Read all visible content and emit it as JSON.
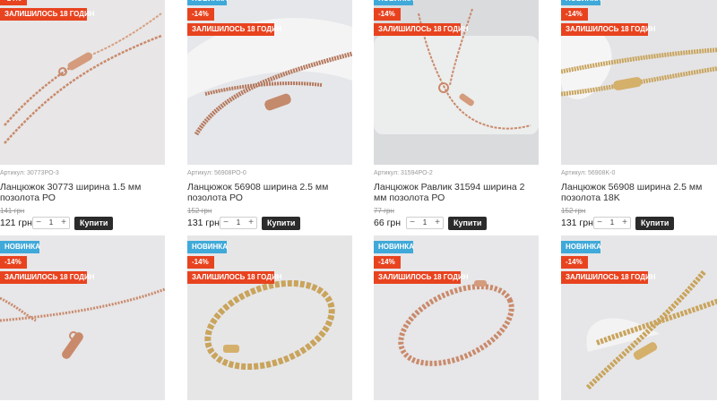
{
  "badges": {
    "new": "НОВИНКА",
    "discount": "-14%",
    "left": "ЗАЛИШИЛОСЬ 18 ГОДИН"
  },
  "buy_label": "Купити",
  "products": [
    {
      "sku": "Артикул: 30773PO-3",
      "name": "Ланцюжок 30773 ширина 1.5 мм позолота РО",
      "old_price": "141 грн",
      "price": "121 грн",
      "qty": "1",
      "show_new": false
    },
    {
      "sku": "Артикул: 56908PO-0",
      "name": "Ланцюжок 56908 ширина 2.5 мм позолота РО",
      "old_price": "152 грн",
      "price": "131 грн",
      "qty": "1",
      "show_new": true
    },
    {
      "sku": "Артикул: 31594PO-2",
      "name": "Ланцюжок Равлик 31594 ширина 2 мм позолота РО",
      "old_price": "77 грн",
      "price": "66 грн",
      "qty": "1",
      "show_new": true
    },
    {
      "sku": "Артикул: 56908K-0",
      "name": "Ланцюжок 56908 ширина 2.5 мм позолота 18K",
      "old_price": "152 грн",
      "price": "131 грн",
      "qty": "1",
      "show_new": true
    },
    {
      "show_new": true
    },
    {
      "show_new": true
    },
    {
      "show_new": true
    },
    {
      "show_new": true
    }
  ],
  "colors": {
    "badge_new": "#3fa9d9",
    "badge_sale": "#e8431f",
    "buy_button": "#2b2b2b",
    "photo_bg": "#e9e9ea",
    "rose_gold": "#c98a6b",
    "yellow_gold": "#c9a45c"
  }
}
